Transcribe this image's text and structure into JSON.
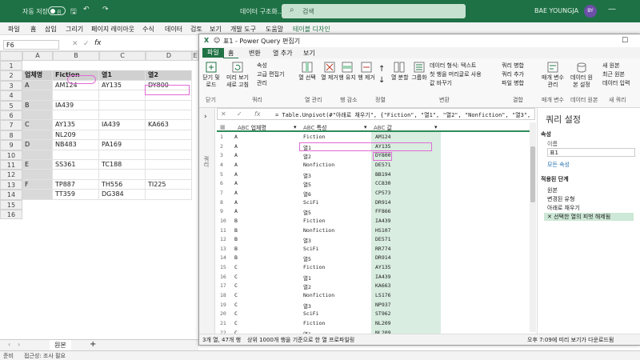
{
  "excel": {
    "autosave_label": "자동 저장",
    "toggle_state": "끔",
    "doc_title": "데이터 구조화...",
    "search_placeholder": "검색",
    "user_name": "BAE YOUNGJA",
    "user_initials": "BY",
    "menu": [
      "파일",
      "홈",
      "삽입",
      "그리기",
      "페이지 레이아웃",
      "수식",
      "데이터",
      "검토",
      "보기",
      "개발 도구",
      "도움말",
      "테이블 디자인"
    ],
    "namebox": "F6",
    "col_headers": [
      "A",
      "B",
      "C",
      "D",
      "E"
    ],
    "row_headers": [
      "1",
      "2",
      "3",
      "4",
      "5",
      "6",
      "7",
      "8",
      "9",
      "10",
      "11",
      "12",
      "13",
      "14",
      "15",
      "16"
    ],
    "table_headers": [
      "업체명",
      "Fiction",
      "열1",
      "열2"
    ],
    "cells": [
      {
        "row": 3,
        "col": "B",
        "text": "A"
      },
      {
        "row": 3,
        "col": "C",
        "text": "AM124"
      },
      {
        "row": 3,
        "col": "D",
        "text": "AY135"
      },
      {
        "row": 3,
        "col": "E",
        "text": "DY800"
      },
      {
        "row": 5,
        "col": "B",
        "text": "B"
      },
      {
        "row": 5,
        "col": "C",
        "text": "IA439"
      },
      {
        "row": 7,
        "col": "B",
        "text": "C"
      },
      {
        "row": 7,
        "col": "C",
        "text": "AY135"
      },
      {
        "row": 7,
        "col": "D",
        "text": "IA439"
      },
      {
        "row": 7,
        "col": "E",
        "text": "KA663"
      },
      {
        "row": 8,
        "col": "C",
        "text": "NL209"
      },
      {
        "row": 9,
        "col": "B",
        "text": "D"
      },
      {
        "row": 9,
        "col": "C",
        "text": "NB483"
      },
      {
        "row": 9,
        "col": "D",
        "text": "PA169"
      },
      {
        "row": 11,
        "col": "B",
        "text": "E"
      },
      {
        "row": 11,
        "col": "C",
        "text": "SS361"
      },
      {
        "row": 11,
        "col": "D",
        "text": "TC188"
      },
      {
        "row": 13,
        "col": "B",
        "text": "F"
      },
      {
        "row": 13,
        "col": "C",
        "text": "TP887"
      },
      {
        "row": 13,
        "col": "D",
        "text": "TH556"
      },
      {
        "row": 13,
        "col": "E",
        "text": "TI225"
      },
      {
        "row": 14,
        "col": "C",
        "text": "TT359"
      },
      {
        "row": 14,
        "col": "D",
        "text": "DG384"
      }
    ],
    "sheet_tab": "원본",
    "status_ready": "준비",
    "status_access": "접근성: 조사 필요"
  },
  "pq": {
    "title": "표1 - Power Query 편집기",
    "tabs": [
      "파일",
      "홈",
      "변환",
      "열 추가",
      "보기"
    ],
    "ribbon_buttons": {
      "close_load": "닫기 및 로드",
      "refresh_preview": "미리 보기 새로 고침",
      "properties": "속성",
      "advanced_editor": "고급 편집기",
      "manage": "관리",
      "choose_columns": "열 선택",
      "remove_columns": "열 제거",
      "keep_rows": "행 유지",
      "remove_rows": "행 제거",
      "split_column": "열 분할",
      "group_by": "그룹화",
      "data_type": "데이터 형식: 텍스트",
      "first_row_header": "첫 행을 머리글로 사용",
      "replace_values": "값 바꾸기",
      "merge_queries": "쿼리 병합",
      "append_queries": "쿼리 추가",
      "combine_files": "파일 병합",
      "manage_params": "매개 변수 관리",
      "data_source_settings": "데이터 원본 설정",
      "new_source": "새 원본",
      "recent_sources": "최근 원본",
      "enter_data": "데이터 입력"
    },
    "groups": [
      "닫기",
      "쿼리",
      "열 관리",
      "행 감소",
      "정렬",
      "변환",
      "결합",
      "매개 변수",
      "데이터 원본",
      "새 쿼리"
    ],
    "formula": "= Table.Unpivot(#\"아래로 채우기\", {\"Fiction\", \"열1\", \"열2\", \"Nonfiction\", \"열3\",",
    "left_label": "쿼리",
    "columns": [
      "업체명",
      "특성",
      "값"
    ],
    "rows": [
      [
        "1",
        "A",
        "Fiction",
        "AM124"
      ],
      [
        "2",
        "A",
        "열1",
        "AY135"
      ],
      [
        "3",
        "A",
        "열2",
        "DY800"
      ],
      [
        "4",
        "A",
        "Nonfiction",
        "DE571"
      ],
      [
        "5",
        "A",
        "열3",
        "BB194"
      ],
      [
        "6",
        "A",
        "열5",
        "CC830"
      ],
      [
        "7",
        "A",
        "열6",
        "CP573"
      ],
      [
        "8",
        "A",
        "SciFi",
        "DR914"
      ],
      [
        "9",
        "A",
        "열5",
        "FF866"
      ],
      [
        "10",
        "B",
        "Fiction",
        "IA439"
      ],
      [
        "11",
        "B",
        "Nonfiction",
        "HS107"
      ],
      [
        "12",
        "B",
        "열3",
        "DE571"
      ],
      [
        "13",
        "B",
        "SciFi",
        "RR774"
      ],
      [
        "14",
        "B",
        "열5",
        "DR914"
      ],
      [
        "15",
        "C",
        "Fiction",
        "AY135"
      ],
      [
        "16",
        "C",
        "열1",
        "IA439"
      ],
      [
        "17",
        "C",
        "열2",
        "KA663"
      ],
      [
        "18",
        "C",
        "Nonfiction",
        "LS176"
      ],
      [
        "19",
        "C",
        "열3",
        "NP937"
      ],
      [
        "20",
        "C",
        "SciFi",
        "ST962"
      ],
      [
        "21",
        "C",
        "Fiction",
        "NL209"
      ],
      [
        "22",
        "C",
        "열1",
        "NL209"
      ]
    ],
    "status_left": "3개 열, 47개 행",
    "status_profile": "상위 1000개 행을 기준으로 한 열 프로파일링",
    "status_right": "오후 7:09에 미리 보기가 다운로드됨",
    "settings": {
      "title": "쿼리 설정",
      "props_section": "속성",
      "name_label": "이름",
      "name_value": "표1",
      "all_props": "모든 속성",
      "steps_section": "적용된 단계",
      "steps": [
        "원본",
        "변경된 유형",
        "아래로 채우기",
        "선택한 열의 피벗 해제됨"
      ]
    }
  }
}
